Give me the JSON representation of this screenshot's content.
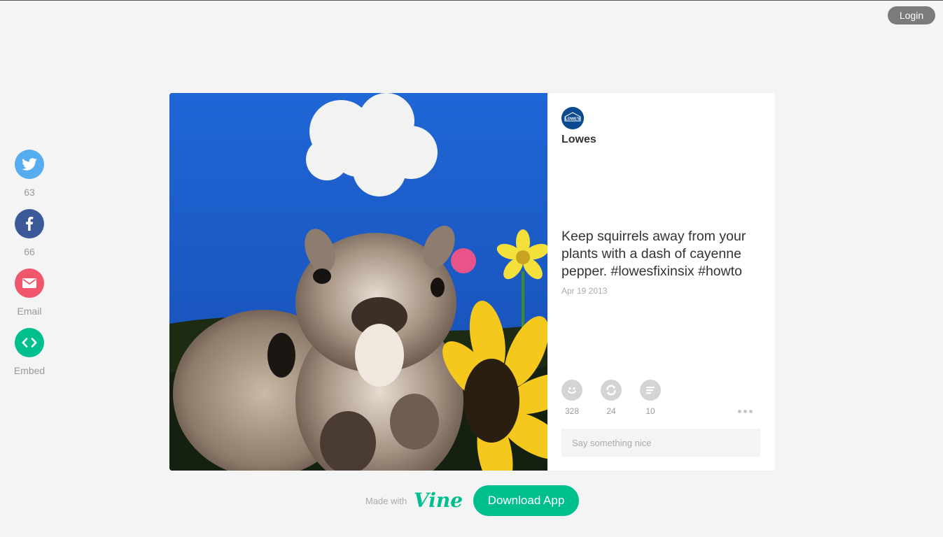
{
  "header": {
    "login_label": "Login"
  },
  "share": {
    "twitter": {
      "count": "63",
      "color": "#55acee",
      "icon": "twitter-bird-icon"
    },
    "facebook": {
      "count": "66",
      "color": "#3b5998",
      "icon": "facebook-f-icon"
    },
    "email": {
      "label": "Email",
      "color": "#f0566c",
      "icon": "envelope-icon"
    },
    "embed": {
      "label": "Embed",
      "color": "#00bf8f",
      "icon": "code-brackets-icon"
    }
  },
  "post": {
    "video_description": "squirrel with sunflower against blue sky",
    "author": {
      "name": "Lowes",
      "avatar_text": "LOWE'S",
      "avatar_color": "#0a4b8f"
    },
    "description": "Keep squirrels away from your plants with a dash of cayenne pepper. #lowesfixinsix #howto",
    "date": "Apr 19 2013",
    "actions": {
      "likes": {
        "count": "328",
        "icon": "smiley-icon"
      },
      "revines": {
        "count": "24",
        "icon": "revine-icon"
      },
      "comments": {
        "count": "10",
        "icon": "comment-icon"
      }
    },
    "comment_placeholder": "Say something nice"
  },
  "footer": {
    "made_with": "Made with",
    "logo_text": "Vine",
    "download_label": "Download App",
    "brand_color": "#00bf8f"
  }
}
